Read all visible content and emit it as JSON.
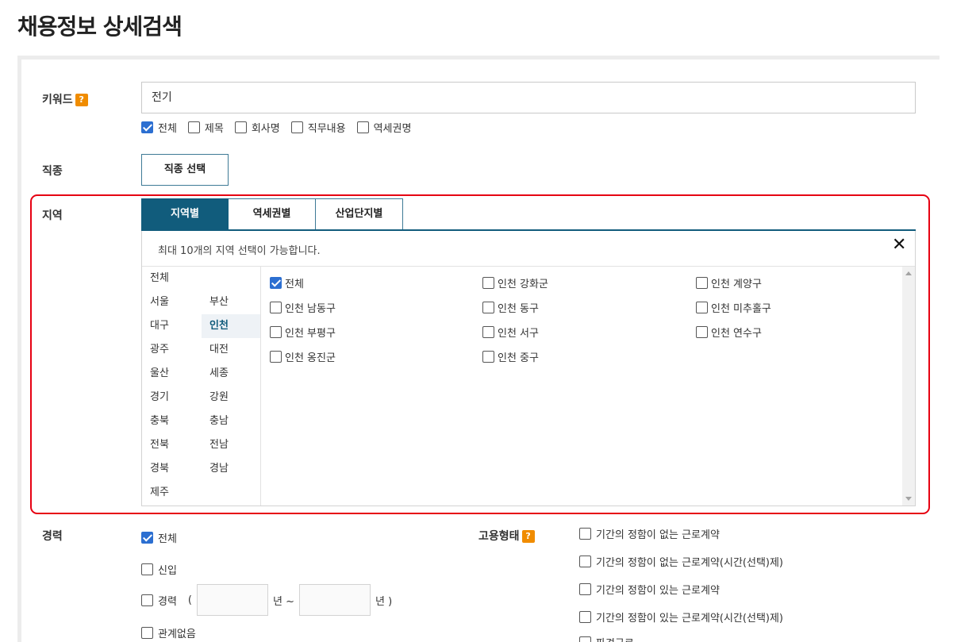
{
  "page": {
    "title": "채용정보 상세검색"
  },
  "keyword": {
    "label": "키워드",
    "help": "?",
    "value": "전기",
    "options": [
      {
        "label": "전체",
        "checked": true
      },
      {
        "label": "제목",
        "checked": false
      },
      {
        "label": "회사명",
        "checked": false
      },
      {
        "label": "직무내용",
        "checked": false
      },
      {
        "label": "역세권명",
        "checked": false
      }
    ]
  },
  "job": {
    "label": "직종",
    "button_label": "직종 선택"
  },
  "region": {
    "label": "지역",
    "tabs": [
      {
        "label": "지역별",
        "active": true
      },
      {
        "label": "역세권별",
        "active": false
      },
      {
        "label": "산업단지별",
        "active": false
      }
    ],
    "notice": "최대 10개의 지역 선택이 가능합니다.",
    "close": "✕",
    "cities": [
      "전체",
      "서울",
      "부산",
      "대구",
      "인천",
      "광주",
      "대전",
      "울산",
      "세종",
      "경기",
      "강원",
      "충북",
      "충남",
      "전북",
      "전남",
      "경북",
      "경남",
      "제주"
    ],
    "selected_city": "인천",
    "districts": [
      {
        "label": "전체",
        "checked": true
      },
      {
        "label": "인천 강화군",
        "checked": false
      },
      {
        "label": "인천 계양구",
        "checked": false
      },
      {
        "label": "인천 남동구",
        "checked": false
      },
      {
        "label": "인천 동구",
        "checked": false
      },
      {
        "label": "인천 미추홀구",
        "checked": false
      },
      {
        "label": "인천 부평구",
        "checked": false
      },
      {
        "label": "인천 서구",
        "checked": false
      },
      {
        "label": "인천 연수구",
        "checked": false
      },
      {
        "label": "인천 옹진군",
        "checked": false
      },
      {
        "label": "인천 중구",
        "checked": false
      }
    ]
  },
  "career": {
    "label": "경력",
    "all": {
      "label": "전체",
      "checked": true
    },
    "new": {
      "label": "신입",
      "checked": false
    },
    "experienced": {
      "label": "경력",
      "checked": false,
      "open_paren": "(",
      "year_from_suffix": "년 ~",
      "year_to_suffix": "년 )"
    },
    "any": {
      "label": "관계없음",
      "checked": false
    }
  },
  "employment": {
    "label": "고용형태",
    "help": "?",
    "options": [
      {
        "label": "기간의 정함이 없는 근로계약",
        "checked": false
      },
      {
        "label": "기간의 정함이 없는 근로계약(시간(선택)제)",
        "checked": false
      },
      {
        "label": "기간의 정함이 있는 근로계약",
        "checked": false
      },
      {
        "label": "기간의 정함이 있는 근로계약(시간(선택)제)",
        "checked": false
      },
      {
        "label": "파견근로",
        "checked": false
      }
    ]
  },
  "colors": {
    "accent": "#115c7c",
    "highlight_border": "#e60012",
    "checkbox_on": "#2c6fd1",
    "help_badge": "#f08c00"
  }
}
